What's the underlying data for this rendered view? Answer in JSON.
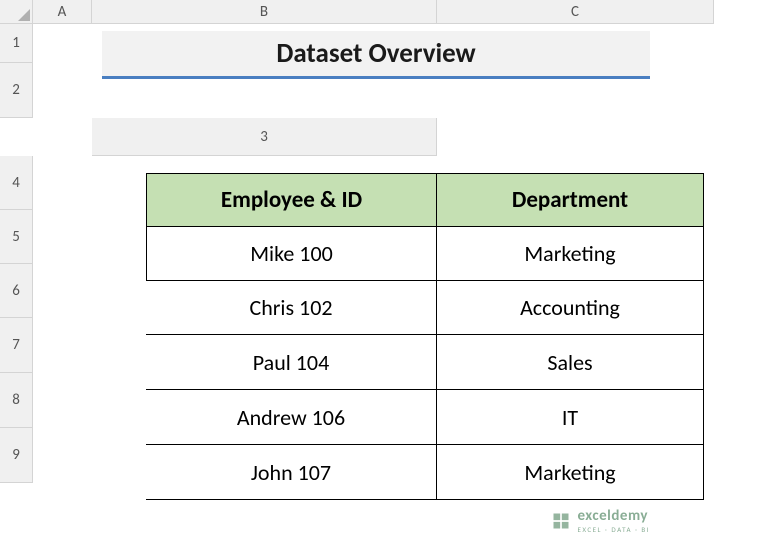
{
  "columns": [
    "A",
    "B",
    "C"
  ],
  "rows": [
    "1",
    "2",
    "3",
    "4",
    "5",
    "6",
    "7",
    "8",
    "9"
  ],
  "title": "Dataset Overview",
  "headers": {
    "col1": "Employee & ID",
    "col2": "Department"
  },
  "data": [
    {
      "emp": "Mike 100",
      "dept": "Marketing"
    },
    {
      "emp": "Chris 102",
      "dept": "Accounting"
    },
    {
      "emp": "Paul 104",
      "dept": "Sales"
    },
    {
      "emp": "Andrew 106",
      "dept": "IT"
    },
    {
      "emp": "John 107",
      "dept": "Marketing"
    }
  ],
  "watermark": {
    "name": "exceldemy",
    "tagline": "EXCEL · DATA · BI"
  }
}
